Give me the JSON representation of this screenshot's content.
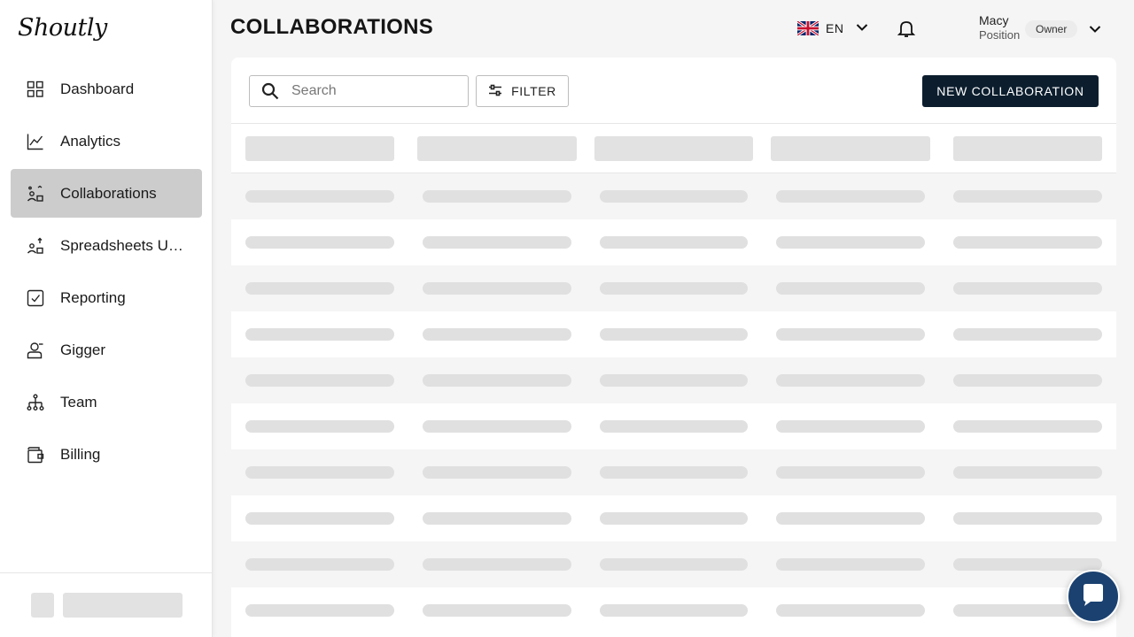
{
  "brand": {
    "logo_text": "Shoutly"
  },
  "sidebar": {
    "items": [
      {
        "label": "Dashboard",
        "icon": "grid-icon"
      },
      {
        "label": "Analytics",
        "icon": "line-chart-icon"
      },
      {
        "label": "Collaborations",
        "icon": "collaborations-icon",
        "active": true
      },
      {
        "label": "Spreadsheets Upload",
        "icon": "spreadsheet-upload-icon"
      },
      {
        "label": "Reporting",
        "icon": "checkbox-icon"
      },
      {
        "label": "Gigger",
        "icon": "user-icon"
      },
      {
        "label": "Team",
        "icon": "team-tree-icon"
      },
      {
        "label": "Billing",
        "icon": "wallet-icon"
      }
    ]
  },
  "header": {
    "title": "COLLABORATIONS",
    "language": {
      "code": "EN",
      "flag": "uk-flag-icon"
    },
    "user": {
      "name": "Macy",
      "position": "Position",
      "role": "Owner"
    }
  },
  "toolbar": {
    "search_placeholder": "Search",
    "filter_label": "FILTER",
    "new_button_label": "NEW COLLABORATION"
  },
  "table": {
    "state": "loading",
    "columns": 5,
    "rows": 10
  },
  "colors": {
    "primary": "#0c1e2e",
    "active_nav": "#cccccc",
    "chat": "#1a4170",
    "skeleton": "#e0e0e0"
  }
}
